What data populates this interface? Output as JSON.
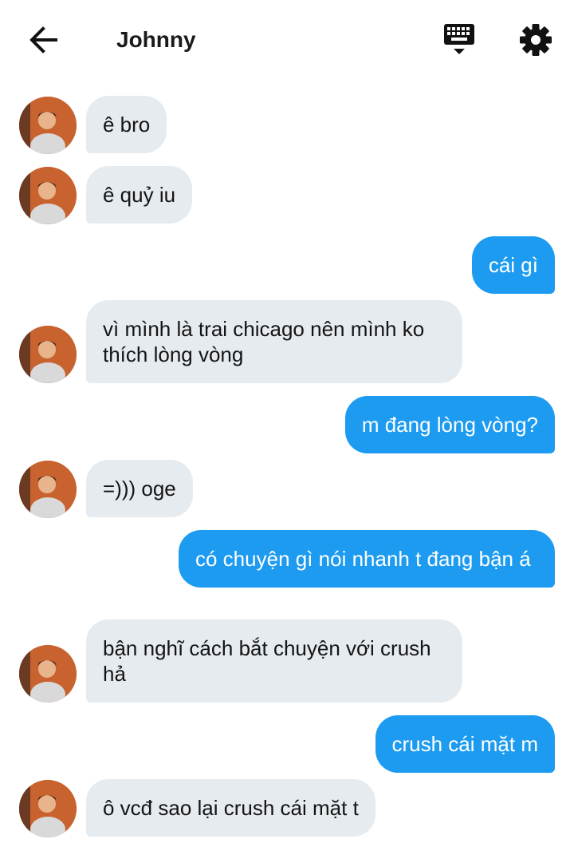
{
  "header": {
    "title": "Johnny",
    "back_icon": "arrow-left-icon",
    "keyboard_icon": "keyboard-icon",
    "settings_icon": "gear-icon"
  },
  "colors": {
    "incoming_bubble": "#e6ebf0",
    "outgoing_bubble": "#1d9bf0",
    "outgoing_text": "#ffffff"
  },
  "messages": [
    {
      "side": "in",
      "text": "ê bro"
    },
    {
      "side": "in",
      "text": "ê quỷ iu"
    },
    {
      "side": "out",
      "text": "cái gì"
    },
    {
      "side": "in",
      "text": "vì mình là trai chicago nên mình ko thích lòng vòng"
    },
    {
      "side": "out",
      "text": "m đang lòng vòng?"
    },
    {
      "side": "in",
      "text": "=))) oge"
    },
    {
      "side": "out",
      "text": "có chuyện gì nói nhanh t đang bận á"
    },
    {
      "side": "in",
      "text": "bận nghĩ cách bắt chuyện với crush hả"
    },
    {
      "side": "out",
      "text": "crush cái mặt m"
    },
    {
      "side": "in",
      "text": "ô vcđ sao lại crush cái mặt t"
    }
  ]
}
